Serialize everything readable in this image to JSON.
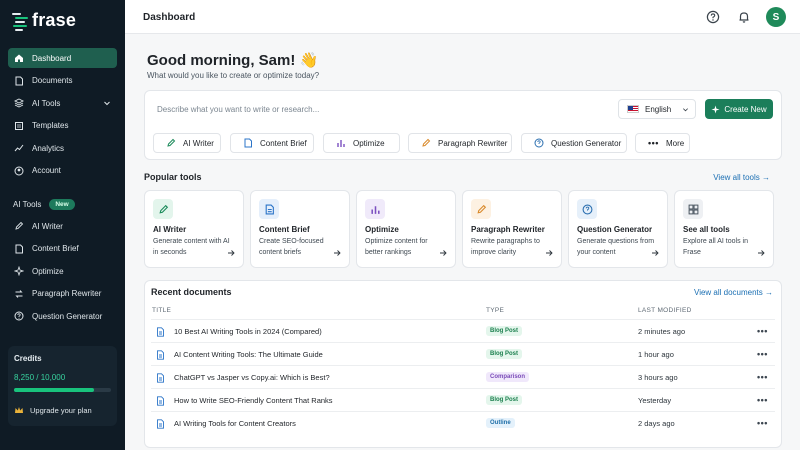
{
  "app": {
    "logo_text": "frase"
  },
  "sidebar": {
    "items": [
      {
        "label": "Dashboard",
        "icon": "home-icon",
        "active": true
      },
      {
        "label": "Documents",
        "icon": "document-icon"
      },
      {
        "label": "AI Tools",
        "icon": "layers-icon",
        "expandable": true
      },
      {
        "label": "Templates",
        "icon": "template-icon"
      },
      {
        "label": "Analytics",
        "icon": "analytics-icon"
      },
      {
        "label": "Account",
        "icon": "account-icon"
      }
    ],
    "tools_heading": "AI Tools",
    "tools_badge": "New",
    "tools": [
      {
        "label": "AI Writer",
        "icon": "pen-icon"
      },
      {
        "label": "Content Brief",
        "icon": "document-icon"
      },
      {
        "label": "Optimize",
        "icon": "optimize-icon"
      },
      {
        "label": "Paragraph Rewriter",
        "icon": "rewrite-icon"
      },
      {
        "label": "Question Generator",
        "icon": "question-icon"
      }
    ],
    "credits": {
      "title": "Credits",
      "value": "8,250 / 10,000",
      "fraction": 0.825,
      "upgrade": "Upgrade your plan"
    }
  },
  "topbar": {
    "title": "Dashboard",
    "avatar": "S"
  },
  "main": {
    "greeting": "Good morning, Sam! 👋",
    "subtitle": "What would you like to create or optimize today?",
    "prompt": {
      "placeholder": "Describe what you want to write or research...",
      "language": "English",
      "create_label": "Create New"
    },
    "chips": [
      {
        "label": "AI Writer",
        "icon": "pen-icon"
      },
      {
        "label": "Content Brief",
        "icon": "document-icon"
      },
      {
        "label": "Optimize",
        "icon": "optimize-icon"
      },
      {
        "label": "Paragraph Rewriter",
        "icon": "rewrite-icon"
      },
      {
        "label": "Question Generator",
        "icon": "question-icon"
      },
      {
        "label": "More",
        "icon": "more-icon"
      }
    ],
    "popular": {
      "title": "Popular tools",
      "view_all": "View all tools →",
      "cards": [
        {
          "name": "AI Writer",
          "desc": "Generate content with AI in seconds",
          "icon": "pen-icon",
          "color": "#1b8a5a",
          "bg": "#e3f5ec"
        },
        {
          "name": "Content Brief",
          "desc": "Create SEO-focused content briefs",
          "icon": "document-icon",
          "color": "#2b74c8",
          "bg": "#e5effb"
        },
        {
          "name": "Optimize",
          "desc": "Optimize content for better rankings",
          "icon": "optimize-icon",
          "color": "#7b4fc0",
          "bg": "#f0eafa"
        },
        {
          "name": "Paragraph Rewriter",
          "desc": "Rewrite paragraphs to improve clarity",
          "icon": "rewrite-icon",
          "color": "#d9892a",
          "bg": "#fdf1e2"
        },
        {
          "name": "Question Generator",
          "desc": "Generate questions from your content",
          "icon": "question-icon",
          "color": "#2b6fb0",
          "bg": "#e6f0fa"
        },
        {
          "name": "See all tools",
          "desc": "Explore all AI tools in Frase",
          "icon": "grid-icon",
          "color": "#4a5560",
          "bg": "#eef0f3"
        }
      ]
    },
    "recent": {
      "title": "Recent documents",
      "view_all": "View all documents →",
      "columns": {
        "title": "TITLE",
        "type": "TYPE",
        "modified": "LAST MODIFIED"
      },
      "rows": [
        {
          "title": "10 Best AI Writing Tools in 2024 (Compared)",
          "type": "Blog Post",
          "kind": "blog",
          "modified": "2 minutes ago"
        },
        {
          "title": "AI Content Writing Tools: The Ultimate Guide",
          "type": "Blog Post",
          "kind": "blog",
          "modified": "1 hour ago"
        },
        {
          "title": "ChatGPT vs Jasper vs Copy.ai: Which is Best?",
          "type": "Comparison",
          "kind": "comp",
          "modified": "3 hours ago"
        },
        {
          "title": "How to Write SEO-Friendly Content That Ranks",
          "type": "Blog Post",
          "kind": "blog",
          "modified": "Yesterday"
        },
        {
          "title": "AI Writing Tools for Content Creators",
          "type": "Outline",
          "kind": "outl",
          "modified": "2 days ago"
        }
      ]
    }
  },
  "colors": {
    "sidebar_bg": "#0f1b25",
    "accent": "#1b7e5a",
    "link": "#1b6fb3"
  }
}
